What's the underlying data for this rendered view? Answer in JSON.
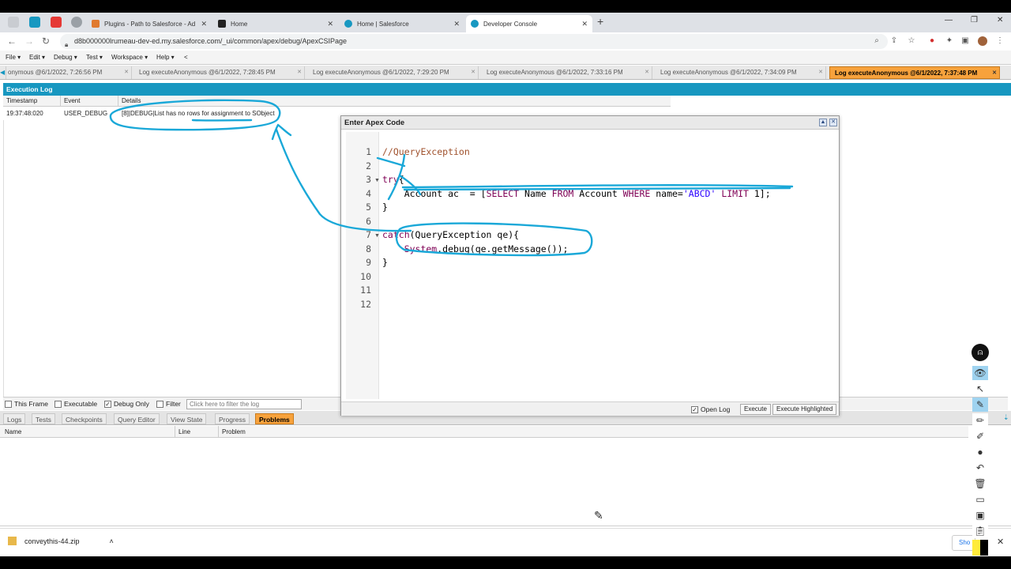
{
  "browser": {
    "tabs": [
      {
        "label": "Plugins - Path to Salesforce - Ad",
        "color": "#e07a2f"
      },
      {
        "label": "Home",
        "color": "#222"
      },
      {
        "label": "Home | Salesforce",
        "color": "#1798c1"
      },
      {
        "label": "Developer Console",
        "color": "#1798c1"
      }
    ],
    "new_tab": "+",
    "url": "d8b000000lrumeau-dev-ed.my.salesforce.com/_ui/common/apex/debug/ApexCSIPage"
  },
  "console_menu": [
    "File ▾",
    "Edit ▾",
    "Debug ▾",
    "Test ▾",
    "Workspace ▾",
    "Help ▾",
    "<"
  ],
  "log_tabs": [
    {
      "label": "onymous @6/1/2022, 7:26:56 PM"
    },
    {
      "label": "Log executeAnonymous @6/1/2022, 7:28:45 PM"
    },
    {
      "label": "Log executeAnonymous @6/1/2022, 7:29:20 PM"
    },
    {
      "label": "Log executeAnonymous @6/1/2022, 7:33:16 PM"
    },
    {
      "label": "Log executeAnonymous @6/1/2022, 7:34:09 PM"
    },
    {
      "label": "Log executeAnonymous @6/1/2022, 7:37:48 PM"
    }
  ],
  "execution_log": {
    "header": "Execution Log",
    "columns": [
      "Timestamp",
      "Event",
      "Details"
    ],
    "row": {
      "timestamp": "19:37:48:020",
      "event": "USER_DEBUG",
      "details": "[8]|DEBUG|List has no rows for assignment to SObject"
    }
  },
  "filters": {
    "this_frame": "This Frame",
    "executable": "Executable",
    "debug_only": "Debug Only",
    "filter": "Filter",
    "filter_placeholder": "Click here to filter the log"
  },
  "bottom_tabs": [
    "Logs",
    "Tests",
    "Checkpoints",
    "Query Editor",
    "View State",
    "Progress",
    "Problems"
  ],
  "problems_columns": [
    "Name",
    "Line",
    "Problem"
  ],
  "apex_dialog": {
    "title": "Enter Apex Code",
    "line_numbers": [
      "1",
      "2",
      "3",
      "4",
      "5",
      "6",
      "7",
      "8",
      "9",
      "10",
      "11",
      "12"
    ],
    "code": {
      "l1": "//QueryException",
      "l3_kw": "try",
      "l3_rest": "{",
      "l4_a": "    Account ac  = [",
      "l4_select": "SELECT",
      "l4_b": " Name ",
      "l4_from": "FROM",
      "l4_c": " Account ",
      "l4_where": "WHERE",
      "l4_d": " name=",
      "l4_str": "'ABCD'",
      "l4_e": " ",
      "l4_limit": "LIMIT",
      "l4_f": " 1];",
      "l5": "}",
      "l7_kw": "catch",
      "l7_rest": "(QueryException qe){",
      "l8_sys": "    System",
      "l8_rest": ".debug(qe.getMessage());",
      "l9": "}"
    },
    "open_log": "Open Log",
    "execute": "Execute",
    "execute_highlighted": "Execute Highlighted"
  },
  "downloads": {
    "file": "conveythis-44.zip",
    "show_all": "Sho"
  },
  "colors": {
    "accent_orange": "#f7a23c",
    "header_blue": "#1797c0",
    "ink": "#1aa8d8"
  }
}
